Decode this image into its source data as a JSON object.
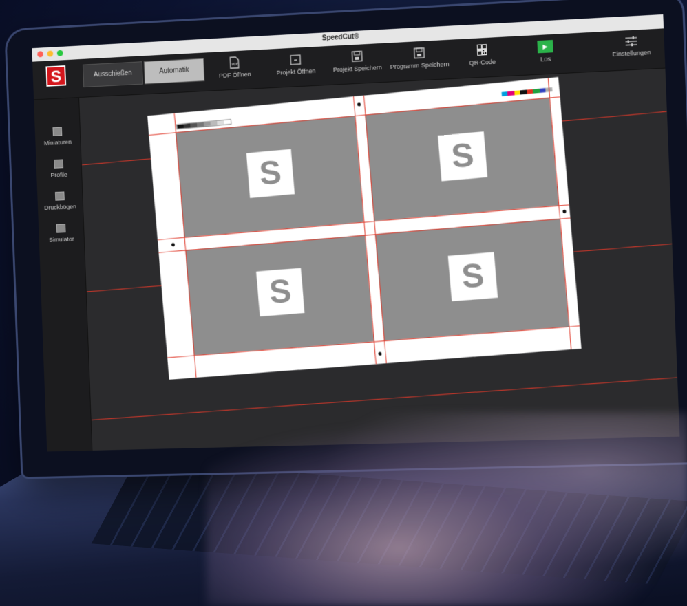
{
  "window": {
    "title": "SpeedCut®"
  },
  "app": {
    "logo_letter": "S"
  },
  "toolbar": {
    "modes": [
      {
        "label": "Ausschießen",
        "active": false
      },
      {
        "label": "Automatik",
        "active": true
      }
    ],
    "tools": [
      {
        "label": "PDF Öffnen",
        "icon": "pdf-file-icon"
      },
      {
        "label": "Projekt Öffnen",
        "icon": "folder-icon"
      },
      {
        "label": "Projekt Speichern",
        "icon": "save-icon"
      },
      {
        "label": "Programm Speichern",
        "icon": "save-icon"
      },
      {
        "label": "QR-Code",
        "icon": "qr-code-icon"
      },
      {
        "label": "Los",
        "icon": "play-icon"
      }
    ],
    "settings_label": "Einstellungen"
  },
  "sidebar": {
    "items": [
      {
        "label": "Miniaturen"
      },
      {
        "label": "Profile"
      },
      {
        "label": "Druckbögen"
      },
      {
        "label": "Simulator"
      }
    ]
  },
  "sheet": {
    "tile_mark": "S",
    "tiles": 4
  },
  "colors": {
    "brand_red": "#d4161c",
    "go_green": "#2bb34a",
    "cut_line": "#e03a2b",
    "tile_gray": "#8e8e8e"
  }
}
